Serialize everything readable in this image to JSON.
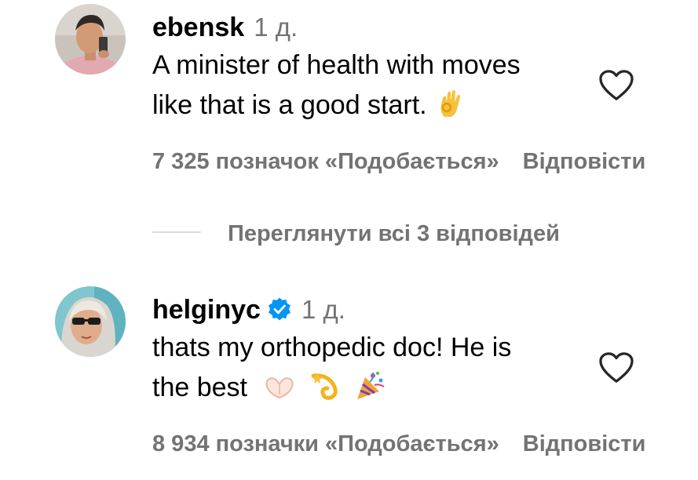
{
  "comments": [
    {
      "username": "ebensk",
      "verified": false,
      "time": "1 д.",
      "text_lines": [
        "A minister of health with moves",
        "like that is a good start."
      ],
      "emojis": [
        "ok-hand-emoji"
      ],
      "likes": "7 325 позначок «Подобається»",
      "reply_label": "Відповісти",
      "avatar_icon": "avatar-man-selfie"
    },
    {
      "username": "helginyc",
      "verified": true,
      "time": "1 д.",
      "text_lines": [
        "thats my orthopedic doc! He is",
        "the best"
      ],
      "emojis": [
        "heart-hands-emoji",
        "dizzy-emoji",
        "party-popper-emoji"
      ],
      "likes": "8 934 позначки «Подобається»",
      "reply_label": "Відповісти",
      "avatar_icon": "avatar-woman-sunglasses"
    }
  ],
  "view_replies": "Переглянути всі 3 відповідей",
  "colors": {
    "text": "#000000",
    "secondary": "#737373",
    "verified": "#0095f6",
    "divider": "#dbdbdb"
  }
}
